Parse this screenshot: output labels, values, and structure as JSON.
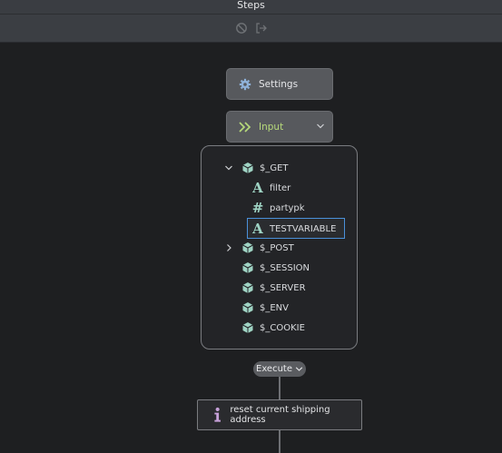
{
  "header": {
    "title": "Steps"
  },
  "toolbar": {
    "icons": [
      "disable-icon",
      "exit-icon"
    ]
  },
  "nodes": {
    "settings": {
      "label": "Settings",
      "icon": "gear-icon"
    },
    "input": {
      "label": "Input",
      "icon": "double-chevron-right-icon"
    }
  },
  "tree": {
    "items": [
      {
        "label": "$_GET",
        "expanded": true
      },
      {
        "label": "filter",
        "type": "string"
      },
      {
        "label": "partypk",
        "type": "number"
      },
      {
        "label": "TESTVARIABLE",
        "type": "string",
        "editing": true
      },
      {
        "label": "$_POST",
        "expanded": false
      },
      {
        "label": "$_SESSION"
      },
      {
        "label": "$_SERVER"
      },
      {
        "label": "$_ENV"
      },
      {
        "label": "$_COOKIE"
      }
    ]
  },
  "execute": {
    "label": "Execute"
  },
  "action": {
    "label": "reset current shipping address",
    "icon": "info-icon"
  },
  "colors": {
    "accent_green": "#b6d97a",
    "teal_icon": "#9fd4c4",
    "focus_blue": "#4a90d9",
    "info_purple": "#c6a0d8"
  }
}
